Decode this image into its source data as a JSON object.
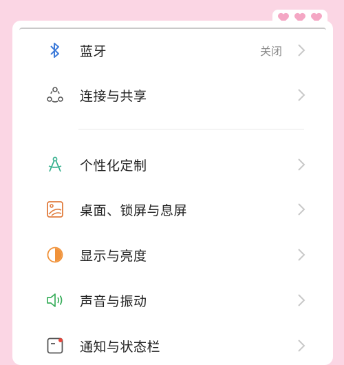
{
  "colors": {
    "background": "#fbd6e4",
    "card": "#ffffff",
    "chevron": "#c8c8c8"
  },
  "settings": {
    "items": [
      {
        "label": "蓝牙",
        "value": "关闭",
        "icon": "bluetooth-icon"
      },
      {
        "label": "连接与共享",
        "value": "",
        "icon": "share-connection-icon"
      },
      {
        "label": "个性化定制",
        "value": "",
        "icon": "personalize-compass-icon"
      },
      {
        "label": "桌面、锁屏与息屏",
        "value": "",
        "icon": "wallpaper-icon"
      },
      {
        "label": "显示与亮度",
        "value": "",
        "icon": "brightness-icon"
      },
      {
        "label": "声音与振动",
        "value": "",
        "icon": "sound-icon"
      },
      {
        "label": "通知与状态栏",
        "value": "",
        "icon": "notification-icon"
      }
    ]
  }
}
